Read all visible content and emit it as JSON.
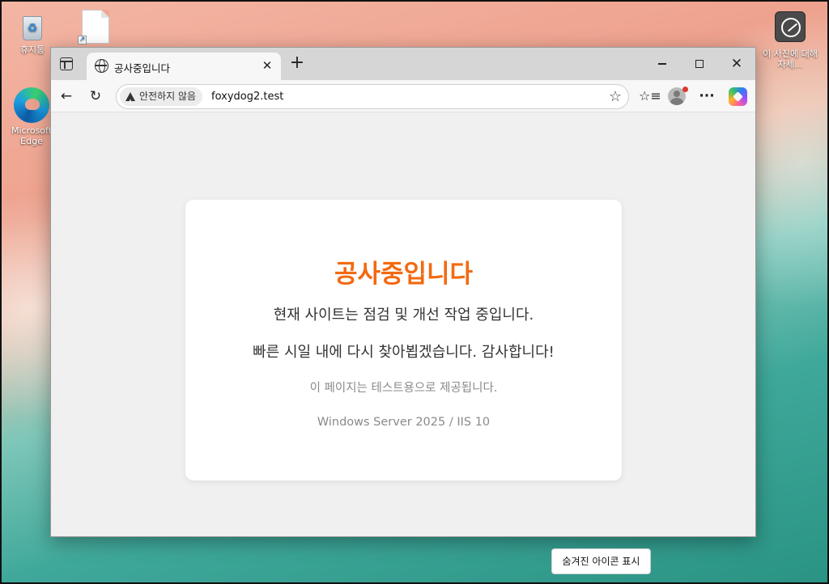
{
  "desktop": {
    "icons": [
      {
        "label": "휴지통",
        "icon": "recycle-bin-icon"
      },
      {
        "label": "",
        "icon": "blank-file-shortcut-icon"
      },
      {
        "label": "Microsoft Edge",
        "icon": "edge-icon"
      },
      {
        "label": "이 사진에 대해 자세...",
        "icon": "learn-about-photo-icon"
      }
    ],
    "taskbar_hint": "숨겨진 아이콘 표시"
  },
  "browser": {
    "tab": {
      "title": "공사중입니다",
      "icon": "globe-icon"
    },
    "toolbar": {
      "security_label": "안전하지 않음",
      "url": "foxydog2.test"
    },
    "window_controls": {
      "minimize": "minimize",
      "maximize": "maximize",
      "close": "close"
    }
  },
  "page": {
    "heading": "공사중입니다",
    "line1": "현재 사이트는 점검 및 개선 작업 중입니다.",
    "line2": "빠른 시일 내에 다시 찾아뵙겠습니다. 감사합니다!",
    "note": "이 페이지는 테스트용으로 제공됩니다.",
    "server": "Windows Server 2025 / IIS 10",
    "colors": {
      "heading": "#f26a12",
      "body_text": "#333333",
      "muted_text": "#8a8a8a"
    }
  }
}
